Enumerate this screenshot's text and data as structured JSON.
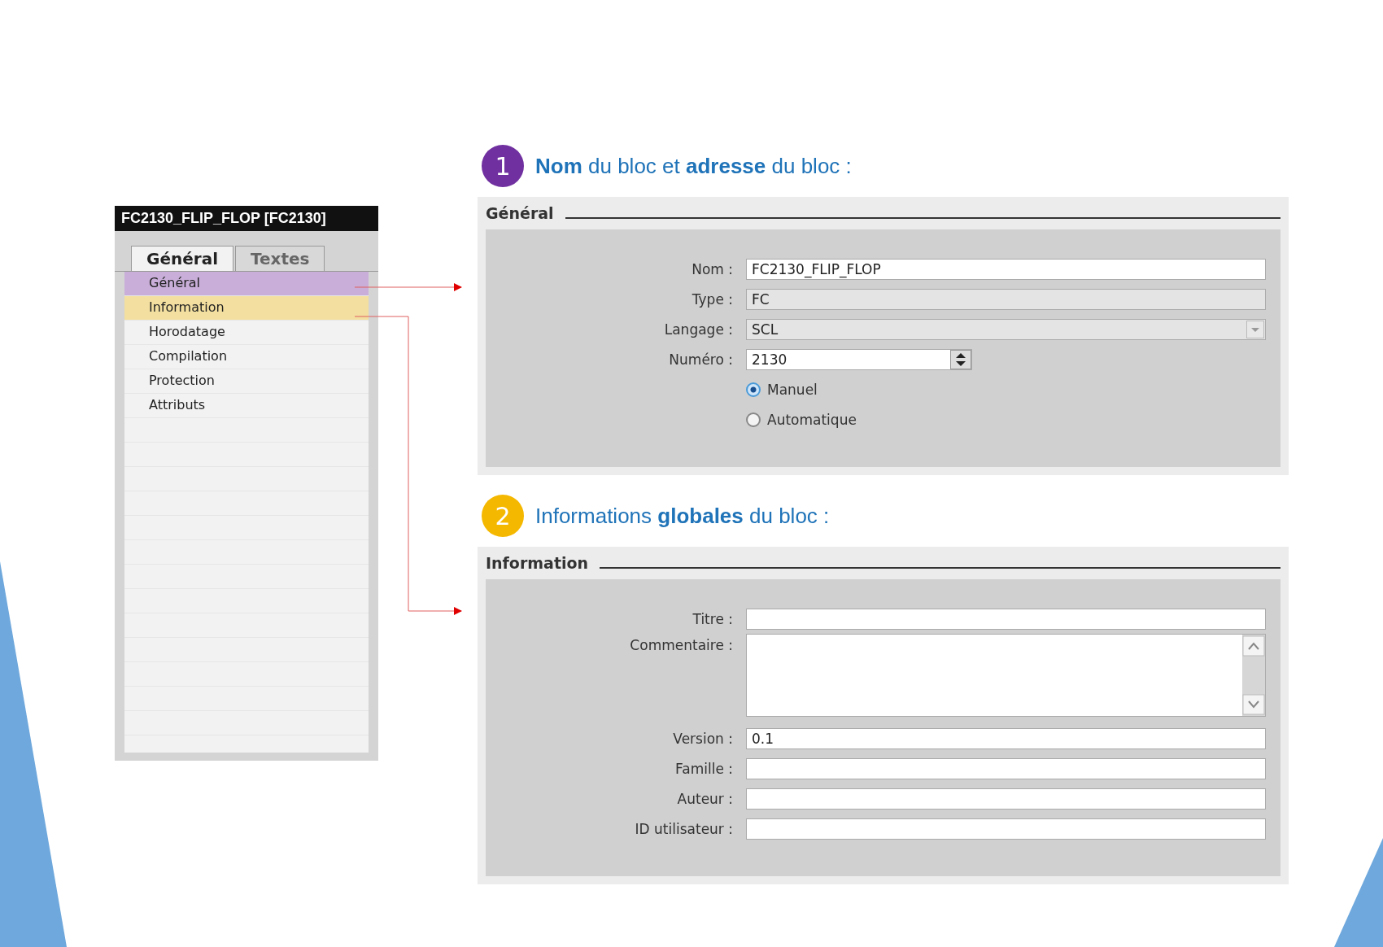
{
  "block_panel": {
    "title": "FC2130_FLIP_FLOP [FC2130]",
    "tabs": [
      {
        "label": "Général",
        "selected": true
      },
      {
        "label": "Textes",
        "selected": false
      }
    ],
    "items": [
      {
        "label": "Général",
        "color": "#c8aed8"
      },
      {
        "label": "Information",
        "color": "#f3e0a0"
      },
      {
        "label": "Horodatage"
      },
      {
        "label": "Compilation"
      },
      {
        "label": "Protection"
      },
      {
        "label": "Attributs"
      }
    ]
  },
  "sections": [
    {
      "number": "1",
      "color": "#7030a0",
      "heading": "**Nom** du bloc et **adresse** du bloc :",
      "panel_title": "Général",
      "fields": [
        {
          "kind": "text",
          "label": "Nom :",
          "value": "FC2130_FLIP_FLOP"
        },
        {
          "kind": "readonly",
          "label": "Type :",
          "value": "FC"
        },
        {
          "kind": "dropdown",
          "label": "Langage :",
          "value": "SCL"
        },
        {
          "kind": "spinner",
          "label": "Numéro :",
          "value": "2130"
        },
        {
          "kind": "radio",
          "label": "Manuel",
          "selected": true
        },
        {
          "kind": "radio",
          "label": "Automatique",
          "selected": false
        }
      ]
    },
    {
      "number": "2",
      "color": "#f5b800",
      "heading": "Informations **globales** du bloc :",
      "panel_title": "Information",
      "fields": [
        {
          "kind": "text",
          "label": "Titre :"
        },
        {
          "kind": "textarea",
          "label": "Commentaire :"
        },
        {
          "kind": "text",
          "label": "Version :",
          "value": "0.1"
        },
        {
          "kind": "text",
          "label": "Famille :"
        },
        {
          "kind": "text",
          "label": "Auteur :"
        },
        {
          "kind": "text",
          "label": "ID utilisateur :"
        }
      ]
    }
  ]
}
